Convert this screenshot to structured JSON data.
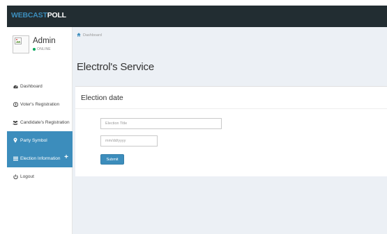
{
  "app": {
    "brand_part1": "WEBCAST",
    "brand_part2": "POLL",
    "brand_color": "#3c8dbc",
    "topbar_color": "#222d32"
  },
  "user": {
    "name": "Admin",
    "status": "ONLINE",
    "avatar_icon": "broken-image-icon"
  },
  "sidebar": {
    "items": [
      {
        "label": "Dashboard",
        "icon": "dashboard-icon",
        "active": false
      },
      {
        "label": "Voter's Registration",
        "icon": "user-plus-icon",
        "active": false
      },
      {
        "label": "Candidate's Registration",
        "icon": "users-icon",
        "active": false
      },
      {
        "label": "Party Symbol",
        "icon": "map-marker-icon",
        "active": true
      },
      {
        "label": "Election Information",
        "icon": "list-icon",
        "active": true,
        "badge": "+"
      },
      {
        "label": "Logout",
        "icon": "power-icon",
        "active": false
      }
    ],
    "active_color": "#3c8dbc"
  },
  "breadcrumb": {
    "label": "Dashboard"
  },
  "page": {
    "title": "Electrol's Service"
  },
  "form": {
    "box_title": "Election date",
    "election_title_placeholder": "Election Title",
    "date_placeholder": "mm/dd/yyyy",
    "submit_label": "Submit"
  }
}
